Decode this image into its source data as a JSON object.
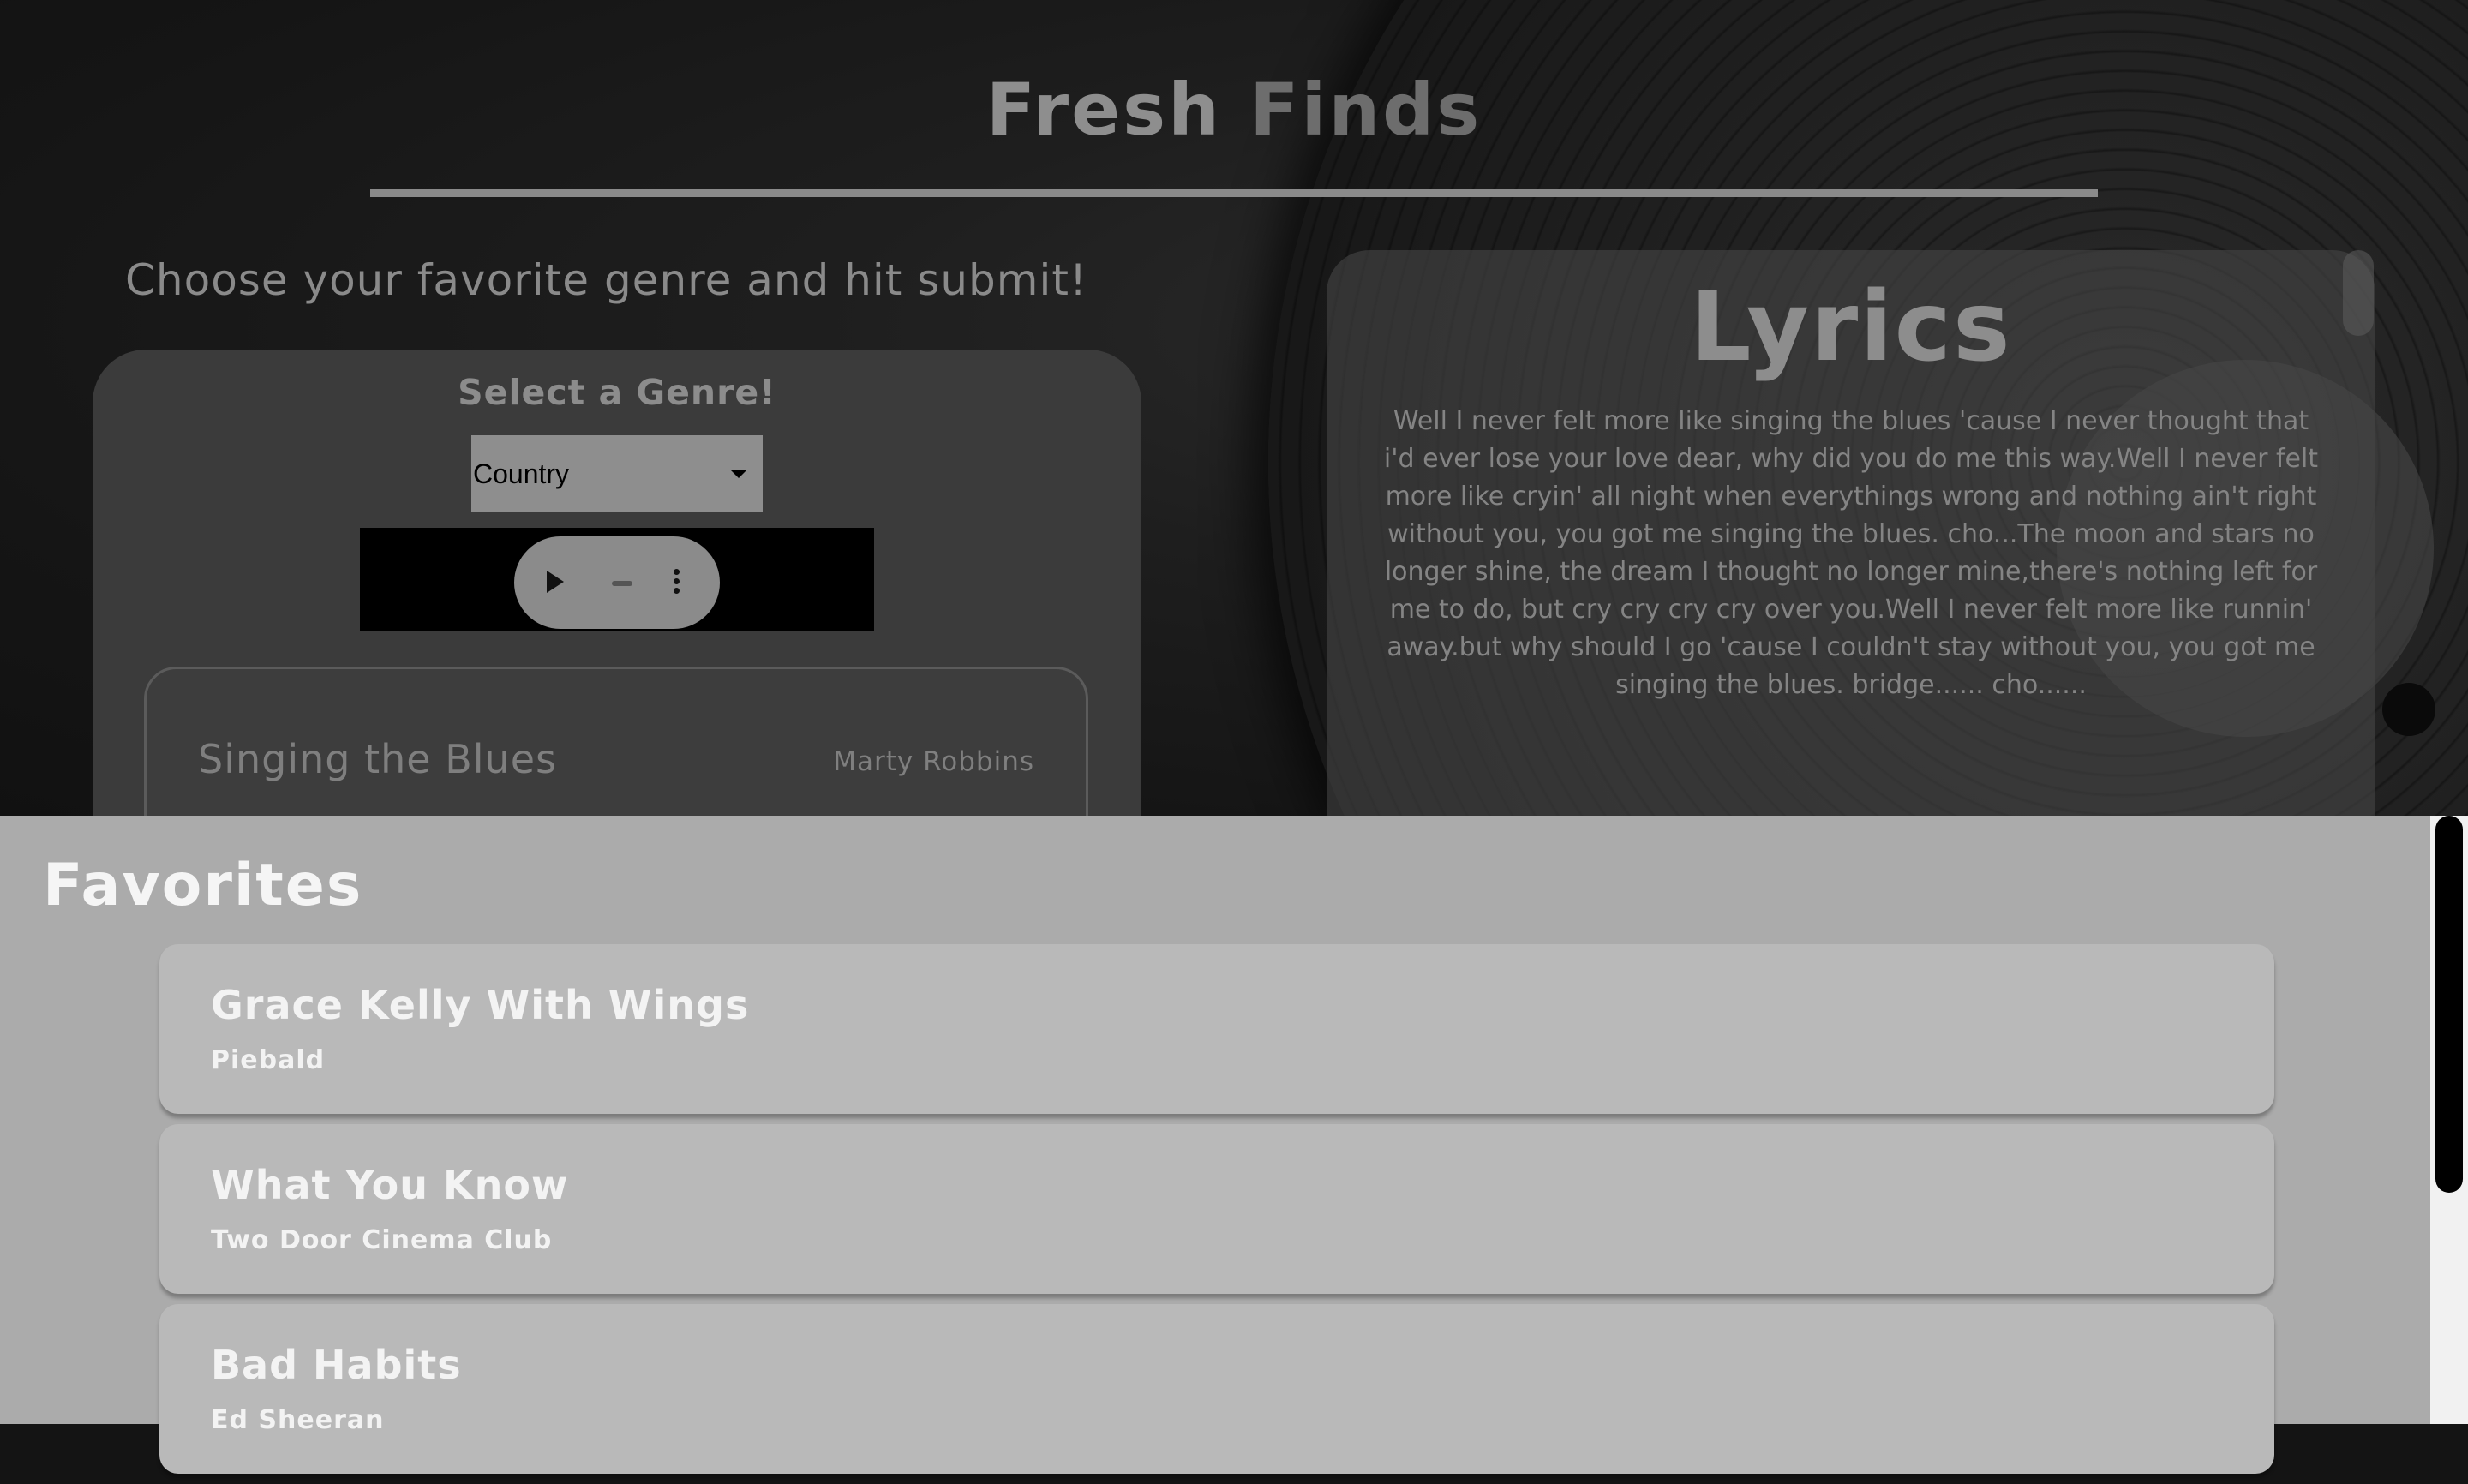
{
  "header": {
    "title_part1": "Fresh",
    "title_part2": "Finds"
  },
  "instructions": "Choose your favorite genre and hit submit!",
  "genre_card": {
    "heading": "Select a Genre!",
    "selected_genre": "Country",
    "audio_progress": 0
  },
  "now_playing": {
    "title": "Singing the Blues",
    "artist": "Marty Robbins"
  },
  "lyrics": {
    "heading": "Lyrics",
    "text": "Well I never felt more like singing the blues 'cause I never thought that i'd ever lose your love dear, why did you do me this way.Well I never felt more like cryin' all night when everythings wrong and nothing ain't right without you, you got me singing the blues. cho...The moon and stars no longer shine, the dream I thought no longer mine,there's nothing left for me to do, but cry cry cry cry over you.Well I never felt more like runnin' away.but why should I go 'cause I couldn't stay without you, you got me singing the blues. bridge...... cho......"
  },
  "favorites": {
    "heading": "Favorites",
    "items": [
      {
        "title": "Grace Kelly With Wings",
        "artist": "Piebald"
      },
      {
        "title": "What You Know",
        "artist": "Two Door Cinema Club"
      },
      {
        "title": "Bad Habits",
        "artist": "Ed Sheeran"
      }
    ]
  },
  "colors": {
    "hero_bg": "#141414",
    "card_bg": "#3b3b3b",
    "favorites_bg": "#ababab",
    "favorite_item_bg": "#b9b9b9",
    "text_muted": "#8a8a8a",
    "text_light": "#f5f5f5"
  },
  "icons": {
    "play": "play-icon",
    "more": "more-vertical-icon"
  }
}
